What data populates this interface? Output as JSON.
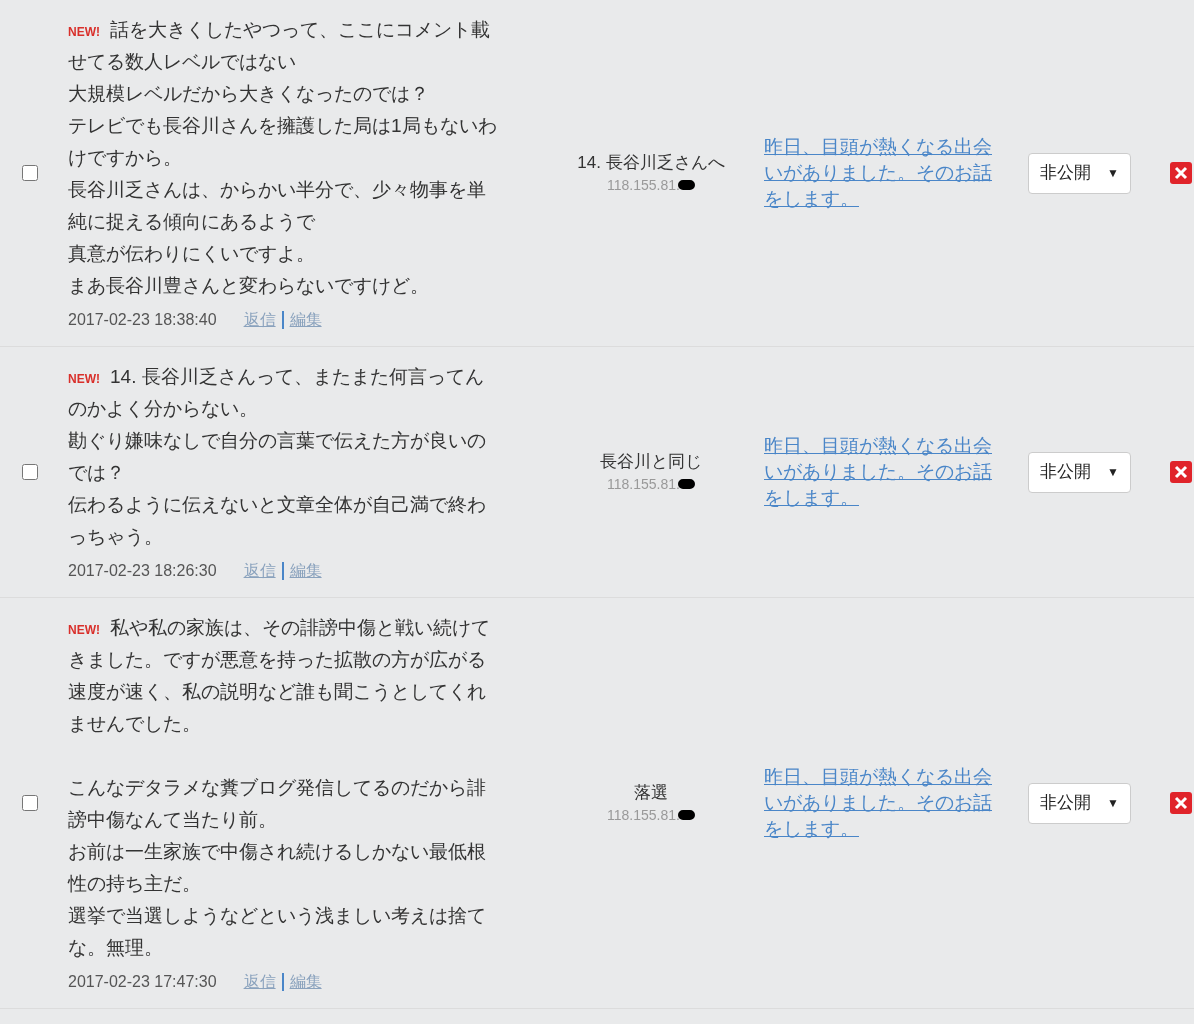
{
  "comments": [
    {
      "checked": false,
      "badge": "NEW!",
      "paragraphs": [
        [
          "話を大きくしたやつって、ここにコメント載",
          "せてる数人レベルではない",
          "大規模レベルだから大きくなったのでは？",
          "テレビでも長谷川さんを擁護した局は1局もないわ",
          "けですから。",
          "長谷川乏さんは、からかい半分で、少々物事を単",
          "純に捉える傾向にあるようで",
          "真意が伝わりにくいですよ。",
          "まあ長谷川豊さんと変わらないですけど。"
        ]
      ],
      "date": "2017-02-23 18:38:40",
      "actions": [
        "返信",
        "編集"
      ],
      "author": "14. 長谷川乏さんへ",
      "ip": "118.155.81.",
      "link": [
        "昨日、目頭が熱くなる出会",
        "いがありました。そのお話",
        "をします。"
      ],
      "visibility": "非公開",
      "caret": "▼"
    },
    {
      "checked": false,
      "badge": "NEW!",
      "paragraphs": [
        [
          "14. 長谷川乏さんって、またまた何言ってん",
          "のかよく分からない。",
          "勘ぐり嫌味なしで自分の言葉で伝えた方が良いの",
          "では？",
          "伝わるように伝えないと文章全体が自己満で終わ",
          "っちゃう。"
        ]
      ],
      "date": "2017-02-23 18:26:30",
      "actions": [
        "返信",
        "編集"
      ],
      "author": "長谷川と同じ",
      "ip": "118.155.81.",
      "link": [
        "昨日、目頭が熱くなる出会",
        "いがありました。そのお話",
        "をします。"
      ],
      "visibility": "非公開",
      "caret": "▼"
    },
    {
      "checked": false,
      "badge": "NEW!",
      "paragraphs": [
        [
          "私や私の家族は、その誹謗中傷と戦い続けて",
          "きました。ですが悪意を持った拡散の方が広がる",
          "速度が速く、私の説明など誰も聞こうとしてくれ",
          "ませんでした。"
        ],
        [
          "こんなデタラメな糞ブログ発信してるのだから誹",
          "謗中傷なんて当たり前。",
          "お前は一生家族で中傷され続けるしかない最低根",
          "性の持ち主だ。",
          "選挙で当選しようなどという浅ましい考えは捨て",
          "な。無理。"
        ]
      ],
      "date": "2017-02-23 17:47:30",
      "actions": [
        "返信",
        "編集"
      ],
      "author": "落選",
      "ip": "118.155.81.",
      "link": [
        "昨日、目頭が熱くなる出会",
        "いがありました。そのお話",
        "をします。"
      ],
      "visibility": "非公開",
      "caret": "▼"
    }
  ]
}
